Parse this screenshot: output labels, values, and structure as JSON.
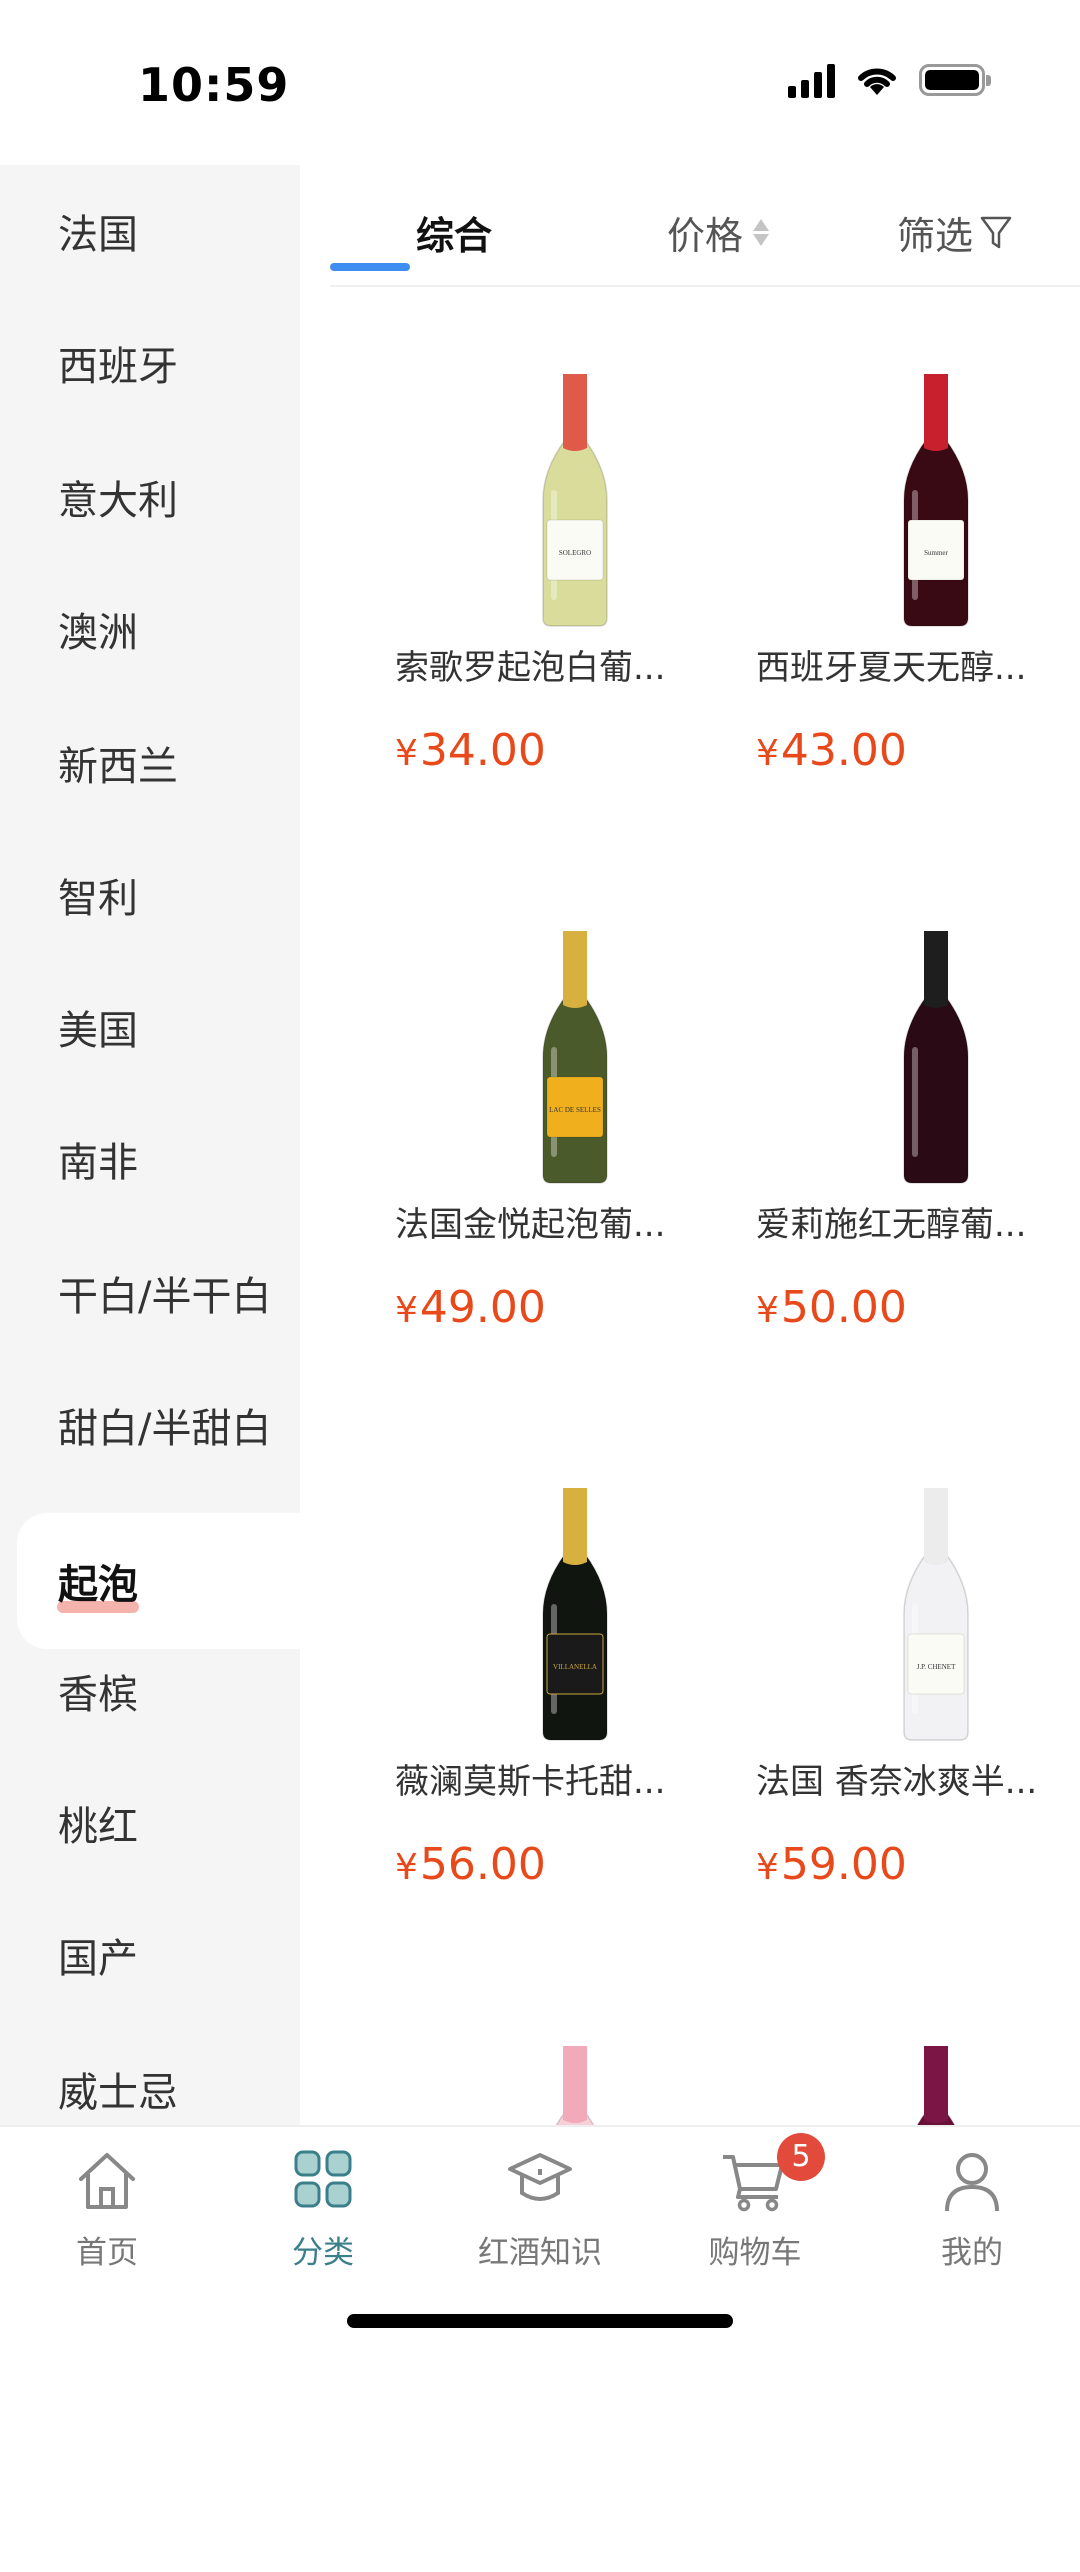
{
  "status_bar": {
    "time": "10:59"
  },
  "sidebar": {
    "items": [
      {
        "label": "法国"
      },
      {
        "label": "西班牙"
      },
      {
        "label": "意大利"
      },
      {
        "label": "澳洲"
      },
      {
        "label": "新西兰"
      },
      {
        "label": "智利"
      },
      {
        "label": "美国"
      },
      {
        "label": "南非"
      },
      {
        "label": "干白/半干白"
      },
      {
        "label": "甜白/半甜白"
      },
      {
        "label": "起泡"
      },
      {
        "label": "香槟"
      },
      {
        "label": "桃红"
      },
      {
        "label": "国产"
      },
      {
        "label": "威士忌"
      }
    ],
    "active_label": "起泡"
  },
  "sortbar": {
    "tabs": [
      {
        "label": "综合"
      },
      {
        "label": "价格"
      },
      {
        "label": "筛选"
      }
    ],
    "active_label": "综合"
  },
  "products": [
    {
      "name": "索歌罗起泡白葡...",
      "currency": "¥",
      "price": "34.00",
      "bottle_label": "SOLEGRO",
      "bottle_color": "#d9dc9a",
      "cap_color": "#e05a4a"
    },
    {
      "name": "西班牙夏天无醇...",
      "currency": "¥",
      "price": "43.00",
      "bottle_label": "Summer",
      "bottle_color": "#3a0a14",
      "cap_color": "#c8202c"
    },
    {
      "name": "法国金悦起泡葡...",
      "currency": "¥",
      "price": "49.00",
      "bottle_label": "LAC DE SELLES",
      "bottle_color": "#4a5a2a",
      "cap_color": "#d8b040"
    },
    {
      "name": "爱莉施红无醇葡...",
      "currency": "¥",
      "price": "50.00",
      "bottle_label": "",
      "bottle_color": "#2a0a14",
      "cap_color": "#1e1e1e"
    },
    {
      "name": "薇澜莫斯卡托甜...",
      "currency": "¥",
      "price": "56.00",
      "bottle_label": "VILLANELLA",
      "bottle_color": "#101510",
      "cap_color": "#d8b040"
    },
    {
      "name": "法国 香奈冰爽半...",
      "currency": "¥",
      "price": "59.00",
      "bottle_label": "J.P. CHENET",
      "bottle_color": "#f2f2f4",
      "cap_color": "#ececec"
    },
    {
      "name": "",
      "currency": "",
      "price": "",
      "bottle_label": "",
      "bottle_color": "#f7d0da",
      "cap_color": "#f2aabb"
    },
    {
      "name": "",
      "currency": "",
      "price": "",
      "bottle_label": "",
      "bottle_color": "#6a1038",
      "cap_color": "#7a1545"
    }
  ],
  "tabbar": {
    "items": [
      {
        "label": "首页",
        "icon": "home-icon"
      },
      {
        "label": "分类",
        "icon": "category-icon"
      },
      {
        "label": "红酒知识",
        "icon": "knowledge-icon"
      },
      {
        "label": "购物车",
        "icon": "cart-icon"
      },
      {
        "label": "我的",
        "icon": "profile-icon"
      }
    ],
    "active_label": "分类",
    "cart_badge": "5"
  },
  "colors": {
    "price": "#e8491b",
    "tab_indicator": "#3d8ef0",
    "active_tab": "#3a7f8a",
    "badge": "#e24b3b"
  }
}
